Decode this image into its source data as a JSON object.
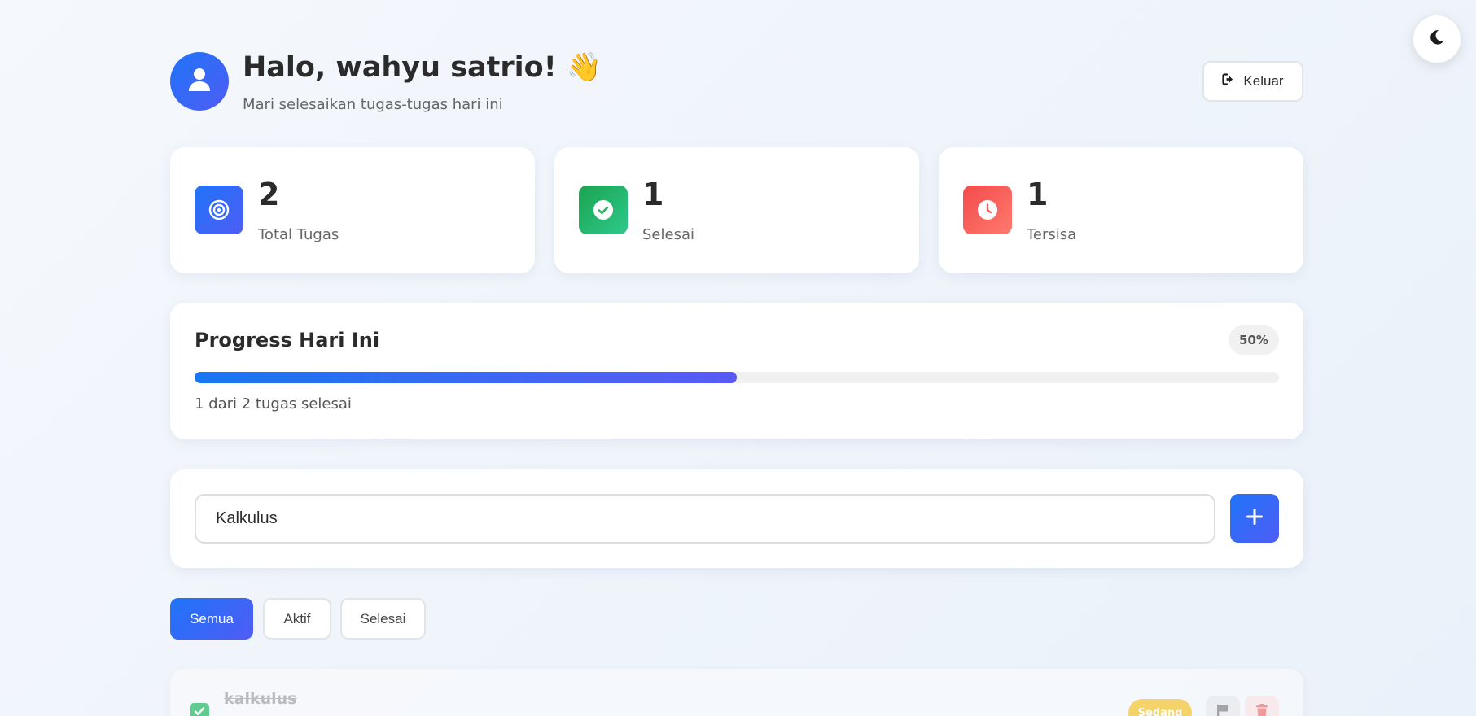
{
  "header": {
    "greeting": "Halo, wahyu satrio! 👋",
    "subtitle": "Mari selesaikan tugas-tugas hari ini",
    "logout_label": "Keluar"
  },
  "stats": [
    {
      "value": "2",
      "label": "Total Tugas",
      "icon": "target-icon",
      "color": "#2f6df6"
    },
    {
      "value": "1",
      "label": "Selesai",
      "icon": "check-circle-icon",
      "color": "#22b866"
    },
    {
      "value": "1",
      "label": "Tersisa",
      "icon": "clock-icon",
      "color": "#f65b5b"
    }
  ],
  "progress": {
    "title": "Progress Hari Ini",
    "percent_label": "50%",
    "percent": 50,
    "summary": "1 dari 2 tugas selesai"
  },
  "add_task": {
    "input_value": "Kalkulus"
  },
  "filters": [
    {
      "label": "Semua",
      "active": true
    },
    {
      "label": "Aktif",
      "active": false
    },
    {
      "label": "Selesai",
      "active": false
    }
  ],
  "tasks": [
    {
      "title": "kalkulus",
      "completed": true,
      "priority": "Sedang"
    }
  ],
  "colors": {
    "accent": "#1f74f8",
    "success": "#22b866",
    "danger": "#f65b5b",
    "warning": "#f8c93a"
  }
}
